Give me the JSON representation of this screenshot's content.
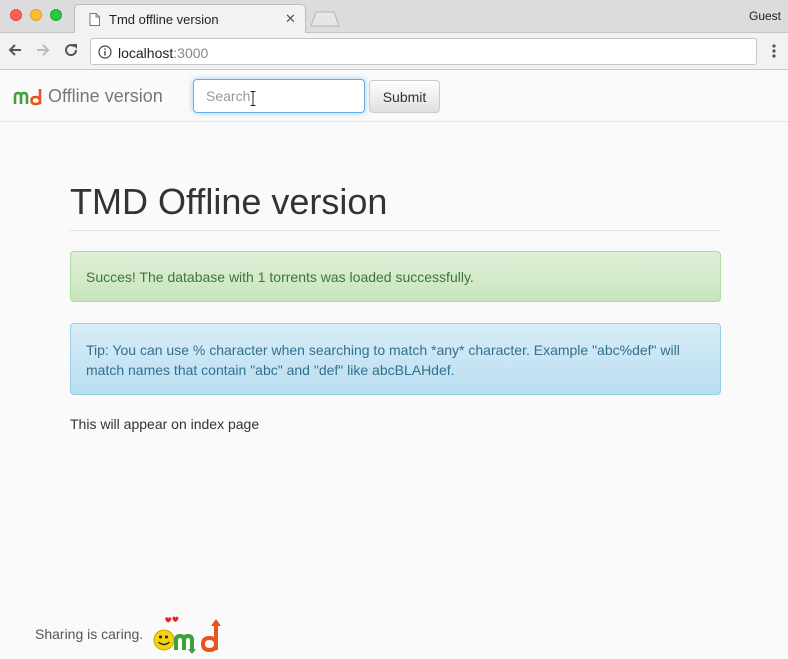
{
  "browser": {
    "tab_title": "Tmd offline version",
    "tab_close": "✕",
    "profile": "Guest",
    "url_host": "localhost",
    "url_port": ":3000"
  },
  "navbar": {
    "brand_text": "Offline version",
    "search_placeholder": "Search",
    "submit_label": "Submit"
  },
  "main": {
    "title": "TMD Offline version",
    "success_alert": "Succes! The database with 1 torrents was loaded successfully.",
    "info_alert": "Tip: You can use % character when searching to match *any* character. Example \"abc%def\" will match names that contain \"abc\" and \"def\" like abcBLAHdef.",
    "index_text": "This will appear on index page"
  },
  "footer": {
    "text": "Sharing is caring."
  },
  "colors": {
    "success_bg": "#dff0d8",
    "success_text": "#3c763d",
    "info_bg": "#d9edf7",
    "info_text": "#31708f",
    "focus_border": "#66afe9"
  }
}
